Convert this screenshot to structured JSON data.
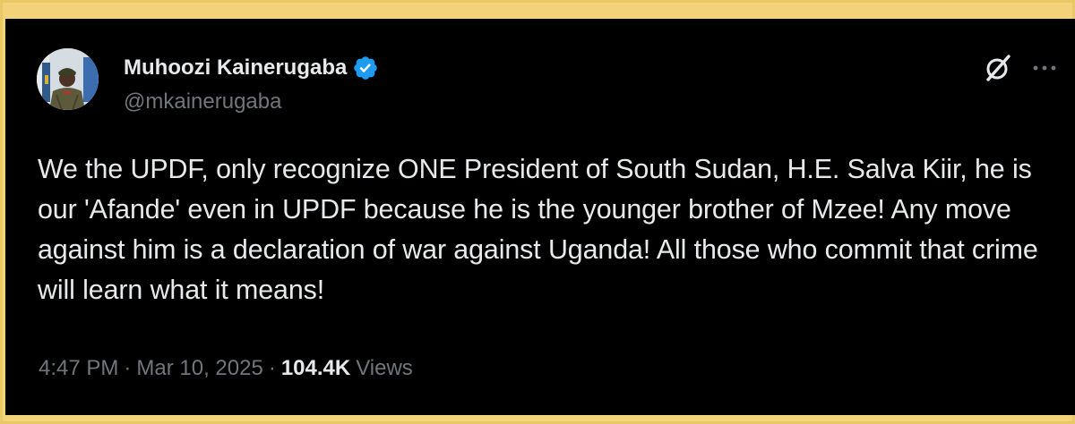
{
  "tweet": {
    "author": {
      "display_name": "Muhoozi Kainerugaba",
      "handle": "@mkainerugaba",
      "verified": true
    },
    "text": "We the UPDF, only recognize ONE President of South Sudan, H.E. Salva Kiir, he is our 'Afande' even in UPDF because he is the younger brother of Mzee! Any move against him is a declaration of war against Uganda! All those who commit that crime will learn what it means!",
    "time": "4:47 PM",
    "separator": "·",
    "date": "Mar 10, 2025",
    "views_count": "104.4K",
    "views_label": "Views"
  },
  "icons": {
    "avatar": "profile-photo",
    "verified": "verified-badge-icon",
    "grok": "grok-icon",
    "more": "more-options-icon"
  },
  "colors": {
    "background": "#000000",
    "frame": "#f3d37a",
    "primary_text": "#e7e9ea",
    "secondary_text": "#71767b",
    "verified_blue": "#1d9bf0"
  }
}
